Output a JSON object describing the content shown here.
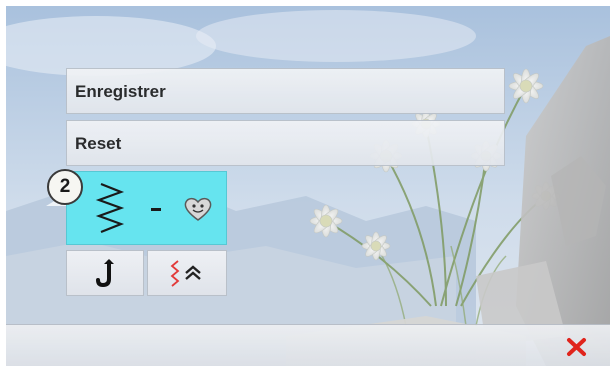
{
  "menu": {
    "save_label": "Enregistrer",
    "reset_label": "Reset"
  },
  "stitch_combination": {
    "badge_number": "2",
    "first_icon": "zigzag-stitch-icon",
    "second_icon": "heart-motif-icon",
    "tile_color": "#66e4ef"
  },
  "tool_buttons": [
    {
      "icon": "needle-stop-icon"
    },
    {
      "icon": "stitch-move-up-icon"
    }
  ],
  "footer": {
    "close_icon": "close-icon",
    "close_color": "#e0241c"
  }
}
